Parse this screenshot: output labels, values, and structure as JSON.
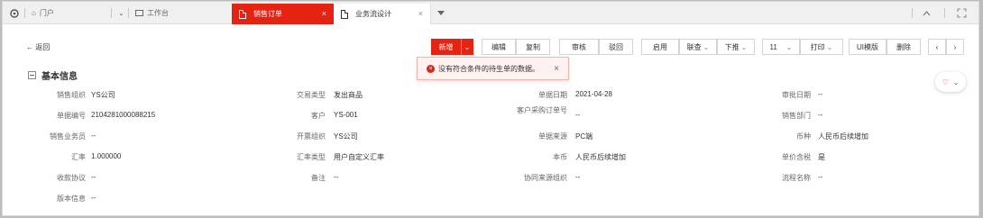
{
  "tabbar": {
    "home_label": "门户",
    "workbench_label": "工作台",
    "active_tab": "销售订单",
    "second_tab": "业务流设计",
    "close_glyph": "×"
  },
  "toolbar": {
    "back_label": "返回",
    "new_label": "新增",
    "edit_label": "编辑",
    "copy_label": "复制",
    "audit_label": "审核",
    "reject_label": "驳回",
    "disable_label": "启用",
    "linked_label": "联查",
    "push_label": "下推",
    "page_value": "11",
    "print_label": "打印",
    "ui_template_label": "UI模版",
    "delete_label": "删除"
  },
  "toast": {
    "message": "没有符合条件的待生单的数据。"
  },
  "section": {
    "title": "基本信息"
  },
  "fields": [
    {
      "label": "销售组织",
      "value": "YS公司"
    },
    {
      "label": "交易类型",
      "value": "发出商品"
    },
    {
      "label": "单据日期",
      "value": "2021-04-28"
    },
    {
      "label": "审批日期",
      "value": "--"
    },
    {
      "label": "单据编号",
      "value": "2104281000088215"
    },
    {
      "label": "客户",
      "value": "YS-001"
    },
    {
      "label": "客户采购订单号",
      "value": "--"
    },
    {
      "label": "销售部门",
      "value": "--"
    },
    {
      "label": "销售业务员",
      "value": "--"
    },
    {
      "label": "开票组织",
      "value": "YS公司"
    },
    {
      "label": "单据来源",
      "value": "PC端"
    },
    {
      "label": "币种",
      "value": "人民币后续增加"
    },
    {
      "label": "汇率",
      "value": "1.000000"
    },
    {
      "label": "汇率类型",
      "value": "用户自定义汇率"
    },
    {
      "label": "本币",
      "value": "人民币后续增加"
    },
    {
      "label": "单价含税",
      "value": "是"
    },
    {
      "label": "收款协议",
      "value": "--"
    },
    {
      "label": "备注",
      "value": "--"
    },
    {
      "label": "协同来源组织",
      "value": "--"
    },
    {
      "label": "流程名称",
      "value": "--"
    },
    {
      "label": "版本信息",
      "value": "--"
    }
  ]
}
